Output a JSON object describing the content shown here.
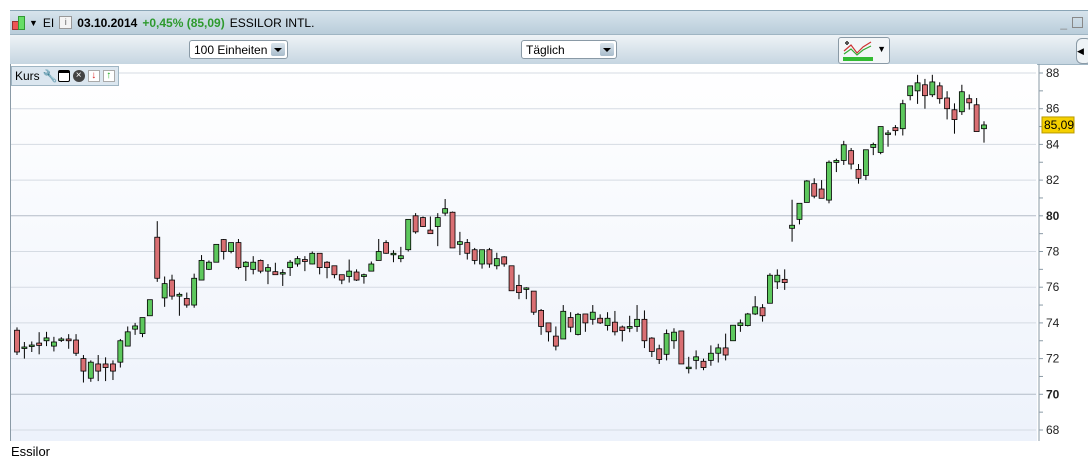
{
  "header": {
    "symbol": "EI",
    "date": "03.10.2014",
    "change": "+0,45% (85,09)",
    "name": "ESSILOR INTL.",
    "change_color": "#2e9a2e"
  },
  "toolbar": {
    "units": "100 Einheiten",
    "interval": "Täglich"
  },
  "panel": {
    "label": "Kurs"
  },
  "footer": {
    "caption": "Essilor"
  },
  "chart_data": {
    "type": "candlestick",
    "ylim": [
      68,
      88
    ],
    "yticks": [
      68,
      70,
      72,
      74,
      76,
      78,
      80,
      82,
      84,
      86,
      88
    ],
    "ytick_labels": [
      "68",
      "70",
      "72",
      "74",
      "76",
      "78",
      "80",
      "82",
      "84",
      "86",
      "88"
    ],
    "last_price_label": "85,09",
    "colors": {
      "up": "#5dc85d",
      "down": "#d96f73"
    },
    "grid": true,
    "ohlc": [
      [
        73.59,
        73.75,
        72.2,
        72.37
      ],
      [
        72.6,
        72.93,
        72.0,
        72.65
      ],
      [
        72.74,
        72.96,
        72.37,
        72.76
      ],
      [
        72.87,
        73.48,
        72.24,
        72.74
      ],
      [
        73.0,
        73.5,
        72.7,
        73.16
      ],
      [
        72.7,
        73.22,
        72.4,
        72.93
      ],
      [
        73.08,
        73.2,
        72.93,
        73.1
      ],
      [
        73.1,
        73.37,
        72.55,
        73.0
      ],
      [
        73.04,
        73.37,
        72.15,
        72.3
      ],
      [
        72.0,
        72.2,
        70.66,
        71.3
      ],
      [
        70.9,
        71.9,
        70.7,
        71.8
      ],
      [
        71.7,
        72.2,
        70.74,
        71.3
      ],
      [
        71.7,
        72.07,
        70.74,
        71.5
      ],
      [
        71.7,
        71.9,
        70.8,
        71.3
      ],
      [
        71.8,
        73.1,
        71.5,
        73.0
      ],
      [
        72.7,
        73.8,
        72.7,
        73.5
      ],
      [
        73.65,
        74.0,
        73.33,
        73.83
      ],
      [
        73.4,
        74.3,
        73.2,
        74.3
      ],
      [
        74.4,
        75.3,
        74.4,
        75.3
      ],
      [
        78.8,
        79.7,
        76.3,
        76.5
      ],
      [
        75.4,
        76.6,
        74.9,
        76.2
      ],
      [
        76.4,
        76.7,
        75.3,
        75.5
      ],
      [
        75.5,
        75.7,
        74.4,
        75.6
      ],
      [
        75.37,
        75.7,
        74.85,
        75.0
      ],
      [
        75.0,
        76.76,
        74.85,
        76.5
      ],
      [
        76.4,
        77.8,
        76.4,
        77.5
      ],
      [
        77.0,
        77.5,
        76.96,
        77.4
      ],
      [
        77.4,
        78.4,
        77.4,
        78.4
      ],
      [
        78.67,
        78.7,
        77.55,
        78.0
      ],
      [
        78.0,
        78.5,
        77.9,
        78.5
      ],
      [
        78.5,
        78.7,
        77.0,
        77.1
      ],
      [
        77.15,
        77.46,
        76.35,
        77.4
      ],
      [
        77.0,
        77.74,
        76.72,
        77.4
      ],
      [
        77.5,
        77.55,
        76.78,
        76.9
      ],
      [
        76.9,
        77.3,
        76.17,
        77.1
      ],
      [
        76.87,
        77.37,
        76.7,
        76.7
      ],
      [
        76.8,
        77.0,
        76.07,
        76.82
      ],
      [
        77.1,
        77.52,
        76.63,
        77.4
      ],
      [
        77.3,
        77.74,
        77.15,
        77.6
      ],
      [
        77.55,
        77.74,
        76.9,
        77.44
      ],
      [
        77.3,
        78.0,
        77.28,
        77.9
      ],
      [
        77.9,
        77.9,
        76.72,
        77.1
      ],
      [
        77.4,
        77.46,
        76.5,
        77.1
      ],
      [
        77.2,
        77.2,
        76.5,
        76.7
      ],
      [
        76.7,
        76.7,
        76.17,
        76.4
      ],
      [
        76.6,
        77.55,
        76.26,
        76.9
      ],
      [
        76.85,
        77.0,
        76.35,
        76.4
      ],
      [
        76.6,
        76.76,
        76.2,
        76.7
      ],
      [
        76.9,
        77.44,
        76.89,
        77.3
      ],
      [
        77.5,
        78.7,
        77.5,
        78.0
      ],
      [
        78.5,
        78.63,
        77.87,
        77.9
      ],
      [
        77.83,
        78.07,
        77.4,
        77.9
      ],
      [
        77.6,
        78.26,
        77.4,
        77.76
      ],
      [
        78.1,
        79.8,
        78.0,
        79.8
      ],
      [
        80.0,
        80.15,
        79.0,
        79.1
      ],
      [
        79.9,
        79.96,
        79.37,
        79.4
      ],
      [
        79.2,
        79.96,
        79.04,
        79.0
      ],
      [
        79.4,
        80.15,
        78.3,
        79.9
      ],
      [
        80.15,
        80.94,
        80.0,
        80.4
      ],
      [
        80.2,
        80.24,
        78.2,
        78.2
      ],
      [
        78.4,
        79.1,
        77.8,
        78.55
      ],
      [
        78.5,
        78.7,
        77.55,
        77.9
      ],
      [
        78.1,
        78.2,
        77.28,
        77.5
      ],
      [
        77.3,
        78.1,
        77.04,
        78.1
      ],
      [
        78.1,
        78.2,
        77.09,
        77.3
      ],
      [
        77.2,
        77.93,
        77.0,
        77.6
      ],
      [
        77.7,
        77.74,
        77.15,
        77.3
      ],
      [
        77.2,
        77.2,
        75.8,
        75.8
      ],
      [
        76.1,
        76.7,
        75.33,
        75.7
      ],
      [
        75.94,
        76.0,
        75.33,
        75.96
      ],
      [
        75.78,
        75.78,
        74.45,
        74.6
      ],
      [
        74.7,
        74.78,
        73.33,
        73.8
      ],
      [
        74.0,
        74.0,
        72.96,
        73.5
      ],
      [
        73.26,
        73.8,
        72.46,
        72.7
      ],
      [
        73.1,
        75.0,
        73.1,
        74.65
      ],
      [
        74.3,
        74.6,
        73.48,
        73.76
      ],
      [
        73.35,
        74.56,
        73.3,
        74.48
      ],
      [
        74.5,
        74.5,
        73.5,
        74.0
      ],
      [
        74.2,
        75.0,
        73.9,
        74.6
      ],
      [
        74.26,
        74.48,
        73.94,
        74.0
      ],
      [
        73.85,
        74.6,
        73.57,
        74.26
      ],
      [
        74.04,
        74.67,
        73.3,
        73.5
      ],
      [
        73.77,
        73.85,
        72.96,
        73.57
      ],
      [
        73.7,
        74.4,
        73.48,
        73.8
      ],
      [
        73.8,
        75.0,
        73.5,
        74.2
      ],
      [
        74.2,
        74.7,
        72.59,
        73.0
      ],
      [
        73.15,
        73.2,
        72.09,
        72.4
      ],
      [
        72.55,
        72.78,
        71.7,
        71.95
      ],
      [
        72.24,
        73.63,
        71.9,
        73.4
      ],
      [
        73.0,
        73.7,
        72.55,
        73.48
      ],
      [
        73.55,
        73.55,
        71.7,
        71.7
      ],
      [
        71.5,
        72.1,
        71.17,
        71.52
      ],
      [
        71.9,
        72.46,
        71.4,
        72.1
      ],
      [
        71.85,
        72.0,
        71.35,
        71.5
      ],
      [
        71.9,
        72.74,
        71.6,
        72.3
      ],
      [
        72.3,
        72.83,
        71.78,
        72.6
      ],
      [
        72.6,
        73.4,
        71.9,
        72.2
      ],
      [
        73.0,
        73.87,
        73.0,
        73.87
      ],
      [
        73.85,
        74.19,
        73.5,
        74.0
      ],
      [
        73.85,
        74.56,
        73.8,
        74.5
      ],
      [
        74.5,
        75.5,
        74.44,
        74.9
      ],
      [
        74.85,
        75.05,
        74.07,
        74.4
      ],
      [
        75.1,
        76.78,
        75.1,
        76.67
      ],
      [
        76.3,
        77.0,
        75.9,
        76.67
      ],
      [
        76.44,
        77.0,
        75.85,
        76.26
      ],
      [
        79.3,
        80.9,
        78.55,
        79.47
      ],
      [
        79.8,
        80.7,
        79.52,
        80.7
      ],
      [
        80.75,
        82.0,
        80.75,
        81.95
      ],
      [
        81.8,
        82.1,
        80.98,
        81.1
      ],
      [
        81.5,
        82.0,
        80.98,
        80.98
      ],
      [
        80.88,
        83.1,
        80.7,
        83.0
      ],
      [
        82.99,
        83.2,
        82.45,
        83.1
      ],
      [
        83.1,
        84.2,
        82.85,
        83.98
      ],
      [
        83.65,
        83.8,
        82.6,
        82.9
      ],
      [
        82.6,
        82.9,
        81.8,
        82.1
      ],
      [
        82.26,
        83.7,
        82.0,
        83.7
      ],
      [
        83.83,
        84.1,
        83.4,
        84.0
      ],
      [
        83.55,
        85.0,
        83.45,
        85.0
      ],
      [
        84.6,
        84.8,
        83.87,
        84.64
      ],
      [
        84.94,
        85.08,
        84.5,
        84.77
      ],
      [
        84.88,
        86.5,
        84.5,
        86.28
      ],
      [
        86.73,
        87.28,
        86.47,
        87.28
      ],
      [
        87.0,
        87.9,
        86.27,
        87.45
      ],
      [
        87.34,
        87.67,
        86.0,
        86.73
      ],
      [
        86.78,
        87.9,
        86.65,
        87.5
      ],
      [
        87.28,
        87.48,
        86.28,
        86.56
      ],
      [
        86.6,
        86.98,
        85.4,
        86.0
      ],
      [
        85.94,
        86.3,
        84.6,
        85.39
      ],
      [
        85.83,
        87.34,
        85.65,
        86.95
      ],
      [
        86.56,
        86.8,
        85.95,
        86.33
      ],
      [
        86.22,
        86.6,
        84.72,
        84.72
      ],
      [
        84.88,
        85.3,
        84.1,
        85.09
      ]
    ]
  }
}
